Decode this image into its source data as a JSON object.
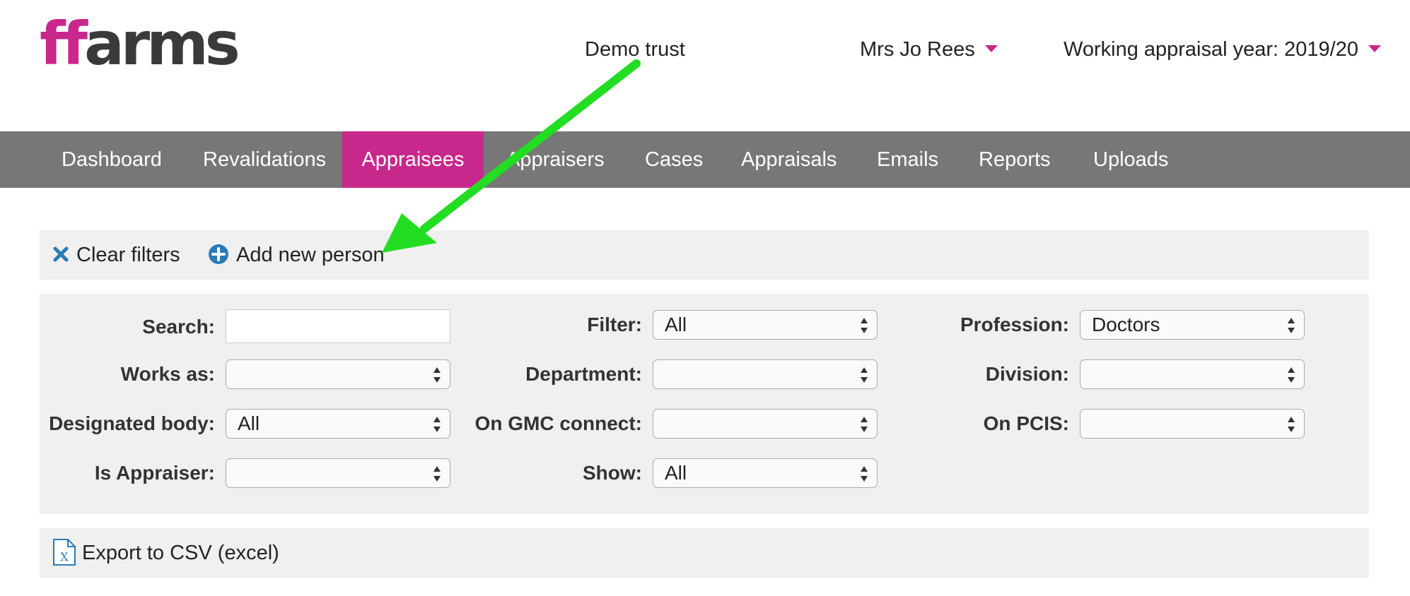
{
  "header": {
    "logo_ff": "ff",
    "logo_rest": "arms",
    "trust": "Demo trust",
    "user": "Mrs Jo Rees",
    "year": "Working appraisal year: 2019/20"
  },
  "nav": {
    "items": [
      "Dashboard",
      "Revalidations",
      "Appraisees",
      "Appraisers",
      "Cases",
      "Appraisals",
      "Emails",
      "Reports",
      "Uploads"
    ],
    "active": "Appraisees"
  },
  "actions": {
    "clear": "Clear filters",
    "add": "Add new person"
  },
  "filters": {
    "search_label": "Search:",
    "search_value": "",
    "filter_label": "Filter:",
    "filter_value": "All",
    "profession_label": "Profession:",
    "profession_value": "Doctors",
    "works_as_label": "Works as:",
    "works_as_value": "",
    "department_label": "Department:",
    "department_value": "",
    "division_label": "Division:",
    "division_value": "",
    "designated_label": "Designated body:",
    "designated_value": "All",
    "gmc_label": "On GMC connect:",
    "gmc_value": "",
    "pcis_label": "On PCIS:",
    "pcis_value": "",
    "appraiser_label": "Is Appraiser:",
    "appraiser_value": "",
    "show_label": "Show:",
    "show_value": "All"
  },
  "export": {
    "label": "Export to CSV (excel)",
    "icon_letter": "X"
  },
  "colors": {
    "brand": "#c8288b",
    "nav_bg": "#777777",
    "annotation_arrow": "#22dd22",
    "icon_blue": "#2a7ab8"
  }
}
